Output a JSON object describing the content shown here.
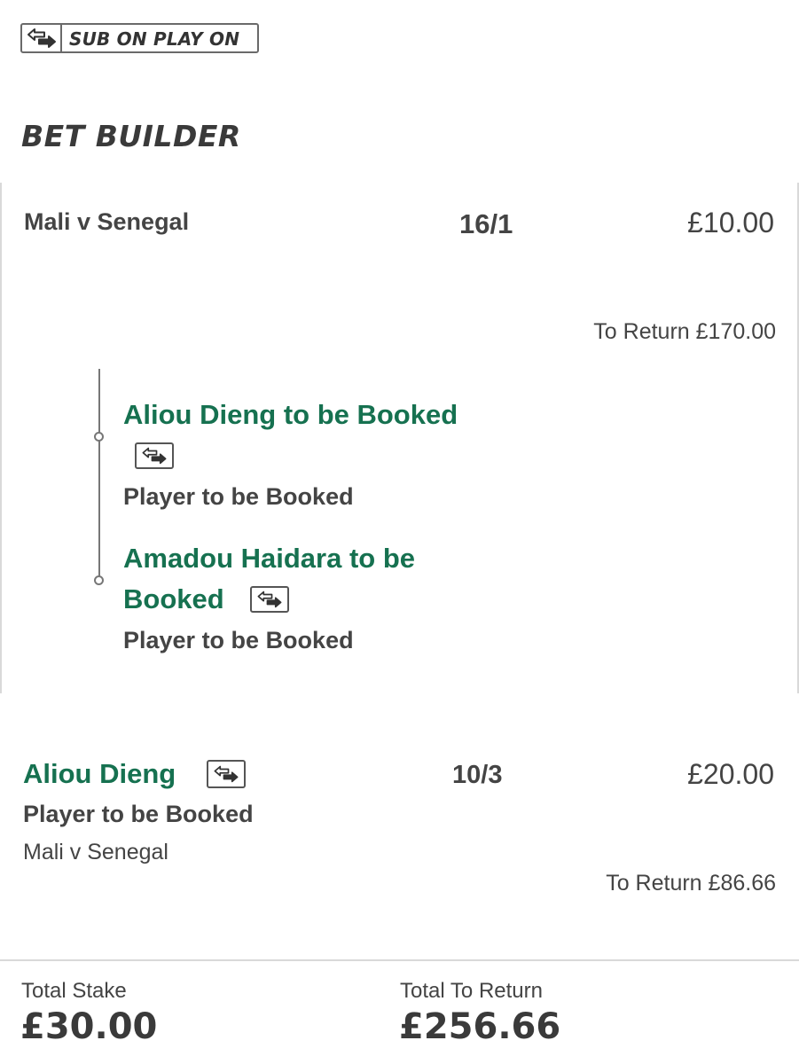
{
  "badge": {
    "label": "SUB ON PLAY ON",
    "icon": "swap-arrows-icon"
  },
  "section_title": "BET BUILDER",
  "bet_builder": {
    "match": "Mali v Senegal",
    "odds": "16/1",
    "stake": "£10.00",
    "to_return": "To Return £170.00",
    "legs": [
      {
        "title_line1": "Aliou Dieng to be Booked",
        "market": "Player to be Booked",
        "icon": "swap-arrows-icon"
      },
      {
        "title_line1": "Amadou Haidara to be",
        "title_line2": "Booked",
        "market": "Player to be Booked",
        "icon": "swap-arrows-icon"
      }
    ]
  },
  "single": {
    "selection": "Aliou Dieng",
    "market": "Player to be Booked",
    "match": "Mali v Senegal",
    "odds": "10/3",
    "stake": "£20.00",
    "to_return": "To Return £86.66",
    "icon": "swap-arrows-icon"
  },
  "footer": {
    "total_stake_label": "Total Stake",
    "total_stake_value": "£30.00",
    "total_return_label": "Total To Return",
    "total_return_value": "£256.66"
  },
  "colors": {
    "selection_green": "#167150",
    "text": "#444444",
    "border": "#d9d9d9"
  }
}
